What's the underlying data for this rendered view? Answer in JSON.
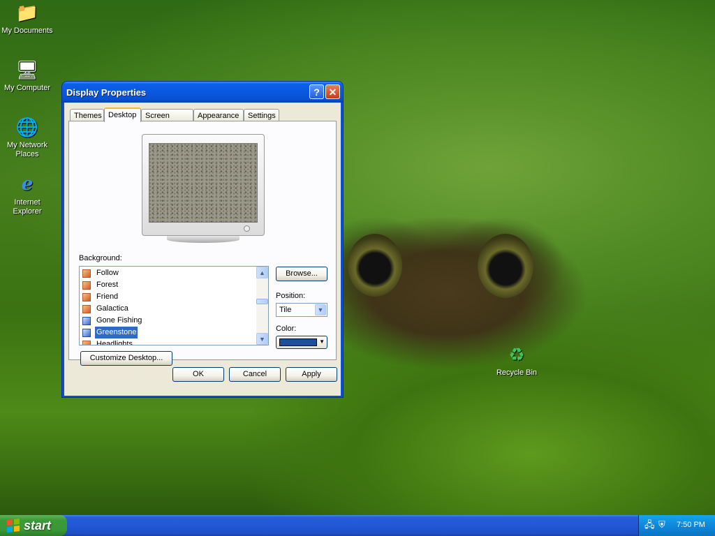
{
  "desktop": {
    "icons": [
      {
        "label": "My Documents",
        "icon": "my-documents-icon"
      },
      {
        "label": "My Computer",
        "icon": "my-computer-icon"
      },
      {
        "label": "My Network Places",
        "icon": "network-places-icon"
      },
      {
        "label": "Internet Explorer",
        "icon": "internet-explorer-icon"
      },
      {
        "label": "Recycle Bin",
        "icon": "recycle-bin-icon"
      }
    ]
  },
  "window": {
    "title": "Display Properties",
    "help_symbol": "?",
    "close_symbol": "✕",
    "tabs": [
      "Themes",
      "Desktop",
      "Screen Saver",
      "Appearance",
      "Settings"
    ],
    "active_tab": "Desktop",
    "background": {
      "label": "Background:",
      "items": [
        {
          "name": "Follow",
          "icon": "picture-file-icon"
        },
        {
          "name": "Forest",
          "icon": "picture-file-icon"
        },
        {
          "name": "Friend",
          "icon": "picture-file-icon"
        },
        {
          "name": "Galactica",
          "icon": "picture-file-icon"
        },
        {
          "name": "Gone Fishing",
          "icon": "pen-file-icon"
        },
        {
          "name": "Greenstone",
          "icon": "pen-file-icon"
        },
        {
          "name": "Headlights",
          "icon": "picture-file-icon"
        }
      ],
      "selected": "Greenstone"
    },
    "browse_label": "Browse...",
    "position": {
      "label": "Position:",
      "value": "Tile"
    },
    "color": {
      "label": "Color:",
      "value": "#1d4f9e"
    },
    "customize_label": "Customize Desktop...",
    "ok_label": "OK",
    "cancel_label": "Cancel",
    "apply_label": "Apply"
  },
  "taskbar": {
    "start_label": "start",
    "clock": "7:50 PM",
    "tray_icons": [
      "network-icon",
      "security-alert-icon"
    ]
  },
  "colors": {
    "title_bar": "#0a58e0",
    "dialog_face": "#ece9d8",
    "selection": "#316ac5",
    "start_button": "#3a9836",
    "taskbar": "#245edb"
  }
}
